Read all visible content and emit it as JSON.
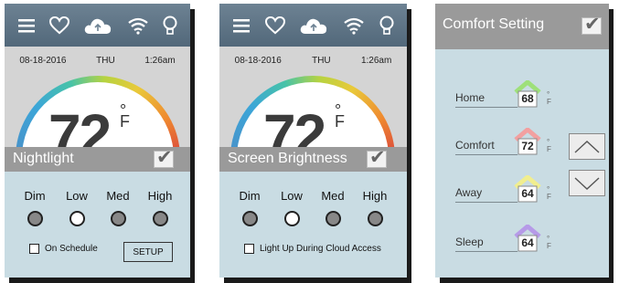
{
  "status": {
    "date": "08-18-2016",
    "day": "THU",
    "time": "1:26am"
  },
  "thermostat": {
    "temperature": "72",
    "unit_symbol": "°",
    "unit_letter": "F"
  },
  "panels": {
    "nightlight": {
      "title": "Nightlight",
      "levels": [
        {
          "label": "Dim",
          "selected": false
        },
        {
          "label": "Low",
          "selected": true
        },
        {
          "label": "Med",
          "selected": false
        },
        {
          "label": "High",
          "selected": false
        }
      ],
      "schedule_label": "On Schedule",
      "setup_label": "SETUP"
    },
    "brightness": {
      "title": "Screen Brightness",
      "levels": [
        {
          "label": "Dim",
          "selected": false
        },
        {
          "label": "Low",
          "selected": true
        },
        {
          "label": "Med",
          "selected": false
        },
        {
          "label": "High",
          "selected": false
        }
      ],
      "cloud_label": "Light Up During Cloud Access"
    },
    "comfort": {
      "title": "Comfort Setting",
      "modes": [
        {
          "name": "Home",
          "value": "68",
          "roof_color": "#9ee07a"
        },
        {
          "name": "Comfort",
          "value": "72",
          "roof_color": "#f2a0a0"
        },
        {
          "name": "Away",
          "value": "64",
          "roof_color": "#f1ee8f"
        },
        {
          "name": "Sleep",
          "value": "64",
          "roof_color": "#b69ae8"
        }
      ],
      "unit_symbol": "°",
      "unit_letter": "F"
    }
  },
  "colors": {
    "topbar": "#5e7486",
    "panel_bg": "#c9dce3",
    "header_gray": "#9a9a9a"
  },
  "icons": [
    "menu-icon",
    "heart-icon",
    "cloud-icon",
    "wifi-icon",
    "lightbulb-icon"
  ]
}
